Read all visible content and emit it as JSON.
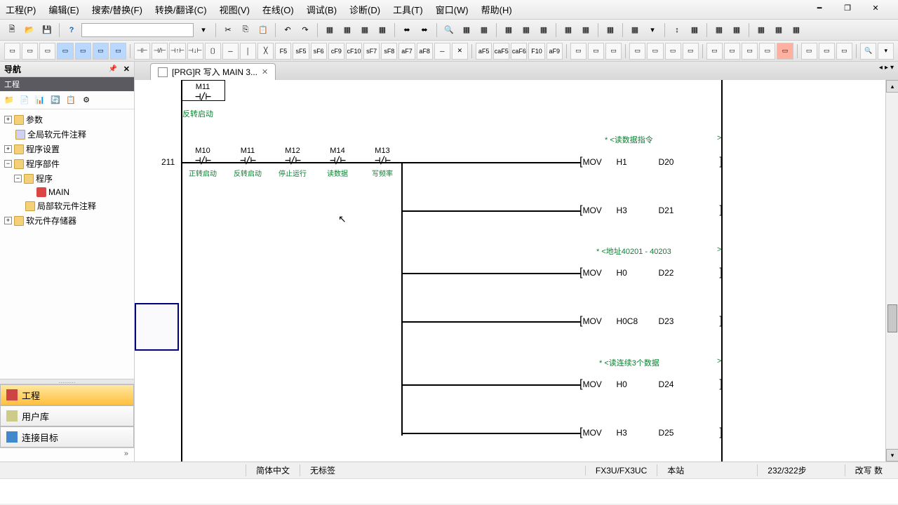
{
  "menu": {
    "items": [
      "工程(P)",
      "编辑(E)",
      "搜索/替换(F)",
      "转换/翻译(C)",
      "视图(V)",
      "在线(O)",
      "调试(B)",
      "诊断(D)",
      "工具(T)",
      "窗口(W)",
      "帮助(H)"
    ]
  },
  "sidebar": {
    "title": "导航",
    "sub": "工程",
    "tree": [
      {
        "exp": "+",
        "label": "参数",
        "indent": 0
      },
      {
        "exp": "",
        "label": "全局软元件注释",
        "indent": 0
      },
      {
        "exp": "+",
        "label": "程序设置",
        "indent": 0
      },
      {
        "exp": "-",
        "label": "程序部件",
        "indent": 0
      },
      {
        "exp": "-",
        "label": "程序",
        "indent": 1
      },
      {
        "exp": "",
        "label": "MAIN",
        "indent": 2,
        "leaf": true
      },
      {
        "exp": "",
        "label": "局部软元件注释",
        "indent": 1
      },
      {
        "exp": "+",
        "label": "软元件存储器",
        "indent": 0
      }
    ],
    "groups": [
      "工程",
      "用户库",
      "连接目标"
    ]
  },
  "tab": {
    "label": "[PRG]R 写入 MAIN 3..."
  },
  "ladder": {
    "topContact": {
      "label": "M11",
      "comment": "反转启动"
    },
    "stepNum": "211",
    "contacts": [
      {
        "label": "M10",
        "comment": "正转启动"
      },
      {
        "label": "M11",
        "comment": "反转启动"
      },
      {
        "label": "M12",
        "comment": "停止运行"
      },
      {
        "label": "M14",
        "comment": "读数据"
      },
      {
        "label": "M13",
        "comment": "写频率"
      }
    ],
    "comments": [
      {
        "text": "<读数据指令"
      },
      {
        "text": "<地址40201 - 40203"
      },
      {
        "text": "<读连续3个数据"
      }
    ],
    "instructions": [
      {
        "op": "MOV",
        "p1": "H1",
        "p2": "D20"
      },
      {
        "op": "MOV",
        "p1": "H3",
        "p2": "D21"
      },
      {
        "op": "MOV",
        "p1": "H0",
        "p2": "D22"
      },
      {
        "op": "MOV",
        "p1": "H0C8",
        "p2": "D23"
      },
      {
        "op": "MOV",
        "p1": "H0",
        "p2": "D24"
      },
      {
        "op": "MOV",
        "p1": "H3",
        "p2": "D25"
      }
    ]
  },
  "status": {
    "lang": "简体中文",
    "tag": "无标签",
    "plc": "FX3U/FX3UC",
    "station": "本站",
    "step": "232/322步",
    "mode": "改写 数"
  }
}
